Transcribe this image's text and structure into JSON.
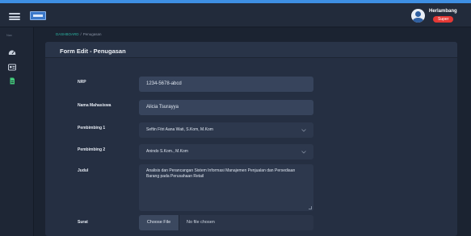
{
  "header": {
    "user_name": "Herlambang",
    "user_role": "Super"
  },
  "sidebar": {
    "caption": "Nav",
    "icons": [
      "dashboard-icon",
      "id-card-icon",
      "document-icon"
    ],
    "active_color": "#43c97a"
  },
  "breadcrumb": {
    "home": "DASHBOARD",
    "separator": "/",
    "current": "Penugasan"
  },
  "form": {
    "title": "Form Edit - Penugasan",
    "fields": {
      "nrp": {
        "label": "NRP",
        "value": "1234-5678-abcd"
      },
      "nama": {
        "label": "Nama Mahasiswa",
        "value": "Alicia Tsurayya"
      },
      "pembimbing1": {
        "label": "Pembimbing 1",
        "value": "Seftin Fitri Aana Wati, S.Kom, M.Kom"
      },
      "pembimbing2": {
        "label": "Pembimbing 2",
        "value": "Anindo S.Kom., M.Kom"
      },
      "judul": {
        "label": "Judul",
        "value": "Analisis dan Perancangan Sistem Informasi Manajemen Penjualan dan Persediaan Barang pada Perusahaan Retail"
      },
      "surat": {
        "label": "Surat",
        "button": "Choose File",
        "status": "No file chosen"
      }
    }
  },
  "colors": {
    "accent": "#3e8fe3",
    "breadcrumb_link": "#2cb3a2",
    "badge": "#e53935"
  }
}
